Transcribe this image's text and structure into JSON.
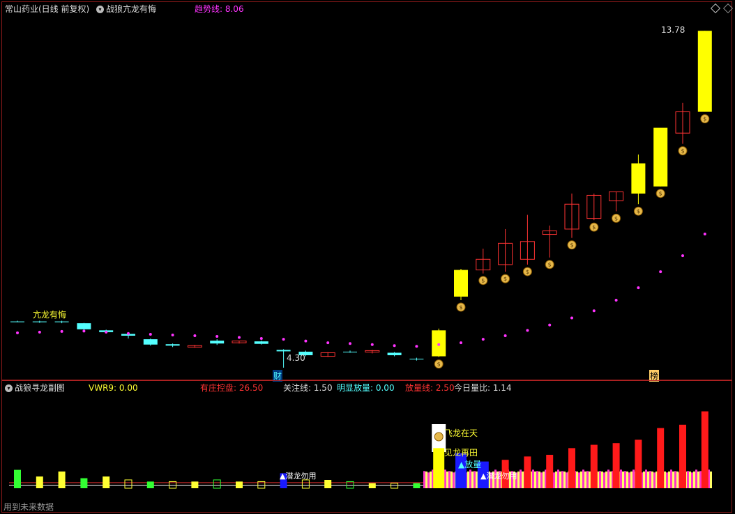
{
  "main": {
    "title": "常山药业(日线 前复权)",
    "indicator_name": "战狼亢龙有悔",
    "trend_label": "趋势线: 8.06",
    "annotation_top": "亢龙有悔",
    "max_label": "13.78",
    "min_label": "4.30",
    "marker_cai": "财",
    "marker_bang": "榜",
    "colors": {
      "up": "#ff3333",
      "down": "#54ffff",
      "signal": "#ffff00",
      "trend": "#ff33ff"
    }
  },
  "sub": {
    "indicator_name": "战狼寻龙副图",
    "vwr9": "VWR9: 0.00",
    "youzhuang": "有庄控盘: 26.50",
    "guanzhu": "关注线: 1.50",
    "mingxian": "明显放量: 0.00",
    "fangliang": "放量线: 2.50",
    "jinri": "今日量比: 1.14",
    "label_qianlong": "▲潜龙勿用",
    "label_feilong": "飞龙在天",
    "label_jianlong": "见龙再田",
    "label_fangliang": "▲放量",
    "label_qianlong2": "▲潜龙勿用",
    "footer": "用到未来数据"
  },
  "chart_data": {
    "type": "candlestick",
    "series": [
      {
        "name": "price",
        "values": [
          {
            "o": 5.6,
            "c": 5.6,
            "h": 5.62,
            "l": 5.58
          },
          {
            "o": 5.6,
            "c": 5.58,
            "h": 5.62,
            "l": 5.56
          },
          {
            "o": 5.6,
            "c": 5.58,
            "h": 5.62,
            "l": 5.55
          },
          {
            "o": 5.55,
            "c": 5.38,
            "h": 5.56,
            "l": 5.35
          },
          {
            "o": 5.35,
            "c": 5.3,
            "h": 5.37,
            "l": 5.28
          },
          {
            "o": 5.25,
            "c": 5.2,
            "h": 5.3,
            "l": 5.12
          },
          {
            "o": 5.1,
            "c": 4.95,
            "h": 5.12,
            "l": 4.92
          },
          {
            "o": 4.96,
            "c": 4.92,
            "h": 4.98,
            "l": 4.88
          },
          {
            "o": 4.88,
            "c": 4.92,
            "h": 4.94,
            "l": 4.86
          },
          {
            "o": 5.06,
            "c": 4.98,
            "h": 5.1,
            "l": 4.94
          },
          {
            "o": 5.0,
            "c": 5.05,
            "h": 5.06,
            "l": 4.98
          },
          {
            "o": 5.04,
            "c": 4.97,
            "h": 5.06,
            "l": 4.95
          },
          {
            "o": 4.8,
            "c": 4.76,
            "h": 4.82,
            "l": 4.3
          },
          {
            "o": 4.75,
            "c": 4.65,
            "h": 4.78,
            "l": 4.62
          },
          {
            "o": 4.62,
            "c": 4.72,
            "h": 4.74,
            "l": 4.6
          },
          {
            "o": 4.75,
            "c": 4.75,
            "h": 4.78,
            "l": 4.72
          },
          {
            "o": 4.74,
            "c": 4.78,
            "h": 4.8,
            "l": 4.7
          },
          {
            "o": 4.72,
            "c": 4.65,
            "h": 4.74,
            "l": 4.62
          },
          {
            "o": 4.55,
            "c": 4.55,
            "h": 4.58,
            "l": 4.5
          },
          {
            "o": 4.62,
            "c": 5.35,
            "h": 5.4,
            "l": 4.6
          },
          {
            "o": 6.3,
            "c": 7.05,
            "h": 7.08,
            "l": 6.2
          },
          {
            "o": 7.05,
            "c": 7.35,
            "h": 7.65,
            "l": 6.95
          },
          {
            "o": 7.2,
            "c": 7.8,
            "h": 8.2,
            "l": 7.0
          },
          {
            "o": 7.35,
            "c": 7.85,
            "h": 8.6,
            "l": 7.2
          },
          {
            "o": 8.05,
            "c": 8.15,
            "h": 8.3,
            "l": 7.4
          },
          {
            "o": 8.2,
            "c": 8.9,
            "h": 9.2,
            "l": 7.95
          },
          {
            "o": 8.5,
            "c": 9.15,
            "h": 9.2,
            "l": 8.45
          },
          {
            "o": 9.0,
            "c": 9.25,
            "h": 9.25,
            "l": 8.7
          },
          {
            "o": 9.2,
            "c": 10.05,
            "h": 10.3,
            "l": 8.9
          },
          {
            "o": 9.4,
            "c": 11.05,
            "h": 11.05,
            "l": 9.4
          },
          {
            "o": 10.9,
            "c": 11.5,
            "h": 11.75,
            "l": 10.6
          },
          {
            "o": 11.5,
            "c": 13.78,
            "h": 13.78,
            "l": 11.5
          }
        ]
      },
      {
        "name": "趋势线",
        "values": [
          5.28,
          5.3,
          5.32,
          5.33,
          5.3,
          5.26,
          5.24,
          5.22,
          5.2,
          5.18,
          5.15,
          5.12,
          5.1,
          5.05,
          5.0,
          4.98,
          4.95,
          4.92,
          4.9,
          4.95,
          5.0,
          5.1,
          5.2,
          5.35,
          5.5,
          5.7,
          5.9,
          6.2,
          6.55,
          7.0,
          7.45,
          8.06
        ]
      }
    ],
    "ylim": [
      4.2,
      14.0
    ],
    "volume_ratio": [
      1.1,
      0.7,
      1.0,
      0.6,
      0.7,
      0.5,
      0.4,
      0.4,
      0.4,
      0.5,
      0.4,
      0.4,
      0.9,
      0.5,
      0.5,
      0.4,
      0.3,
      0.3,
      0.3,
      2.4,
      2.1,
      1.6,
      1.7,
      1.9,
      2.0,
      2.4,
      2.6,
      2.7,
      2.9,
      3.6,
      3.8,
      4.6
    ]
  }
}
